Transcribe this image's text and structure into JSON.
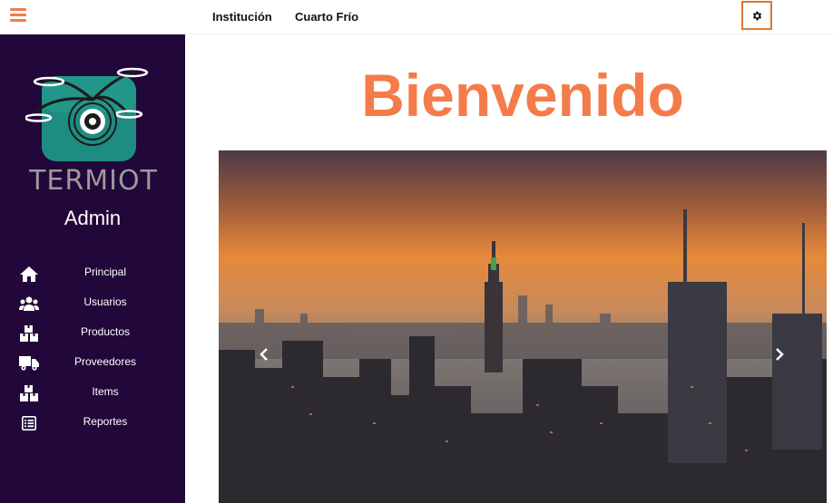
{
  "header": {
    "menu_icon": "hamburger-icon",
    "links": [
      "Institución",
      "Cuarto Frío"
    ],
    "settings_icon": "gear-icon"
  },
  "sidebar": {
    "logo_text": "TERMIOT",
    "role": "Admin",
    "items": [
      {
        "label": "Principal",
        "icon": "home-icon"
      },
      {
        "label": "Usuarios",
        "icon": "users-icon"
      },
      {
        "label": "Productos",
        "icon": "boxes-icon"
      },
      {
        "label": "Proveedores",
        "icon": "truck-icon"
      },
      {
        "label": "Items",
        "icon": "boxes-icon"
      },
      {
        "label": "Reportes",
        "icon": "report-icon"
      }
    ]
  },
  "main": {
    "title": "Bienvenido",
    "carousel": {
      "image": "city-skyline-sunset",
      "prev_icon": "chevron-left-icon",
      "next_icon": "chevron-right-icon"
    }
  },
  "colors": {
    "accent": "#f47c4a",
    "sidebar_bg": "#22073a",
    "settings_border": "#e0782f"
  }
}
